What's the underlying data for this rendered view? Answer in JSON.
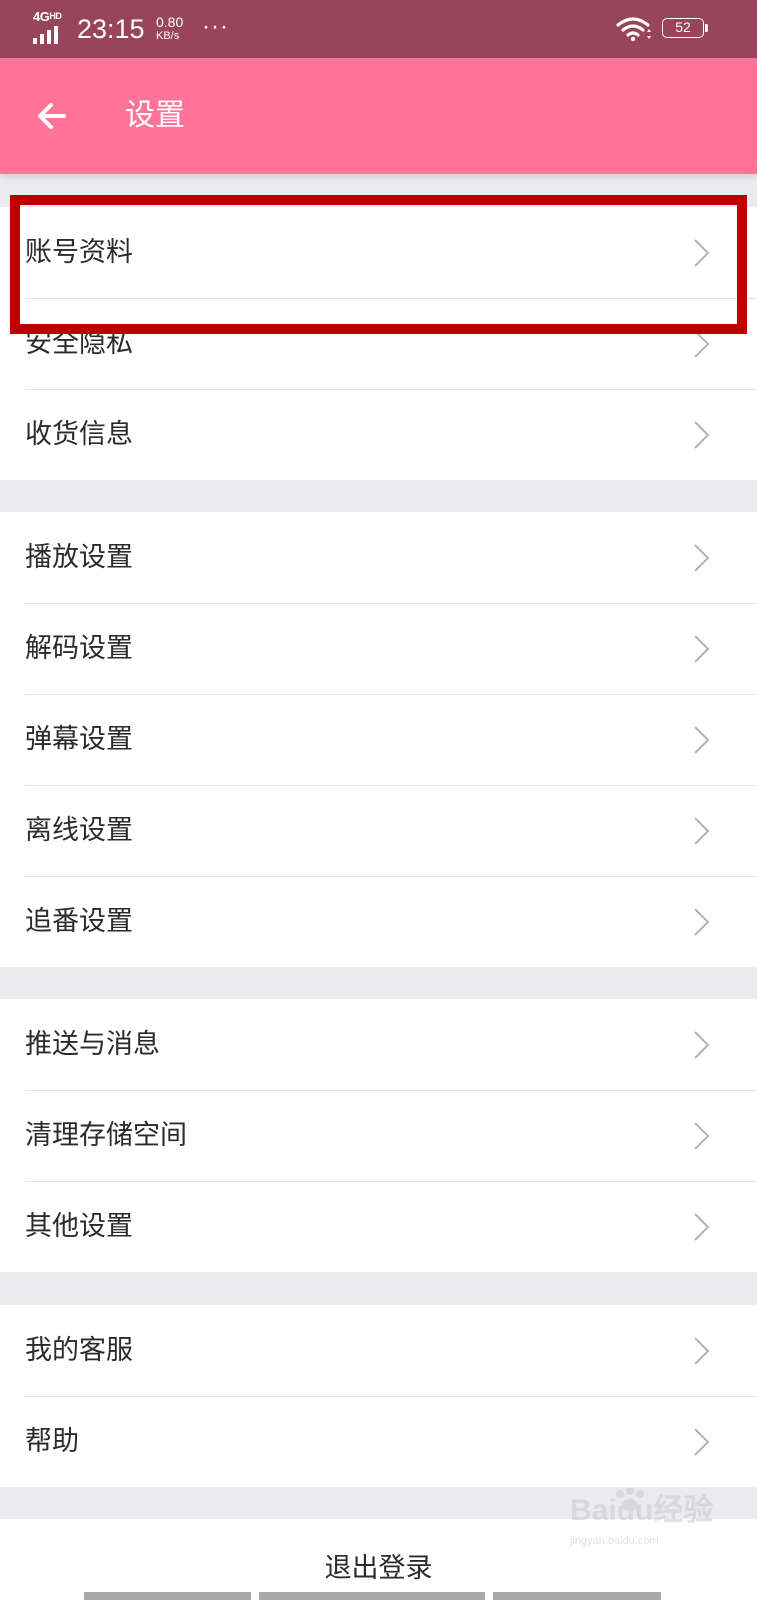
{
  "status_bar": {
    "network": "4G",
    "network_sup": "HD",
    "time": "23:15",
    "speed_value": "0.80",
    "speed_unit": "KB/s",
    "more": "···",
    "battery": "52"
  },
  "header": {
    "title": "设置",
    "background": "#fe7499"
  },
  "menu": {
    "group1": [
      {
        "label": "账号资料"
      },
      {
        "label": "安全隐私"
      },
      {
        "label": "收货信息"
      }
    ],
    "group2": [
      {
        "label": "播放设置"
      },
      {
        "label": "解码设置"
      },
      {
        "label": "弹幕设置"
      },
      {
        "label": "离线设置"
      },
      {
        "label": "追番设置"
      }
    ],
    "group3": [
      {
        "label": "推送与消息"
      },
      {
        "label": "清理存储空间"
      },
      {
        "label": "其他设置"
      }
    ],
    "group4": [
      {
        "label": "我的客服"
      },
      {
        "label": "帮助"
      }
    ]
  },
  "logout": {
    "label": "退出登录"
  },
  "annotation": {
    "color": "#be0000"
  },
  "watermark": {
    "text": "Baidu经验",
    "sub": "jingyan.baidu.com"
  },
  "colors": {
    "status_bar": "#97445c",
    "group_gap": "#ebeaee",
    "text": "#2b2b2b",
    "chevron": "#b3b3b3"
  }
}
